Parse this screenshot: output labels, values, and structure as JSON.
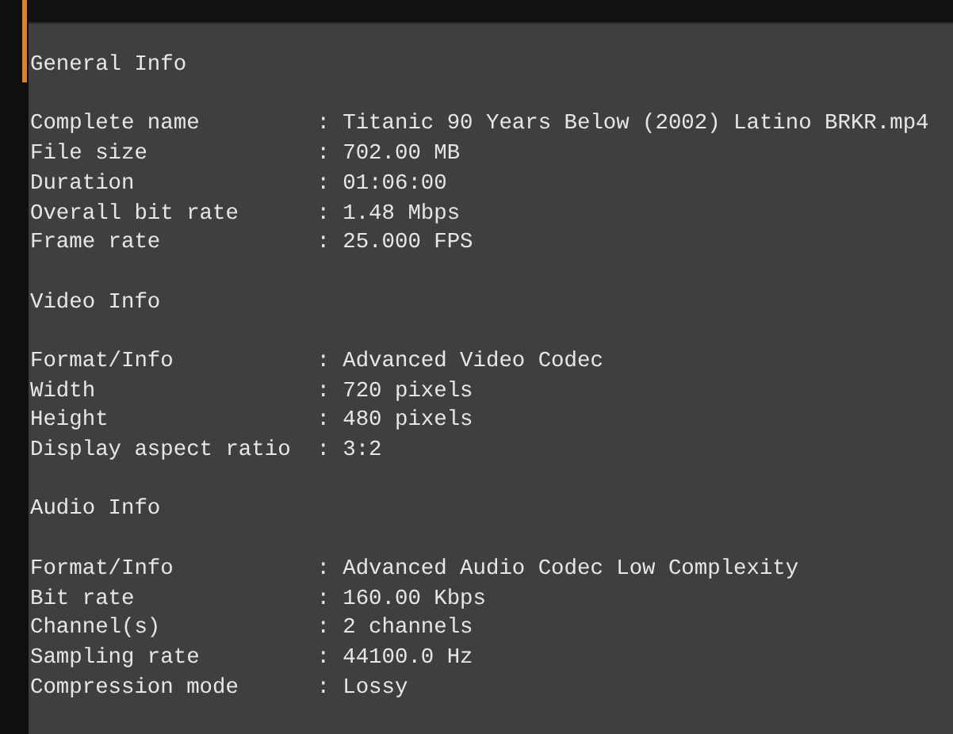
{
  "sections": [
    {
      "heading": "General Info",
      "rows": [
        {
          "label": "Complete name",
          "separator": ":",
          "value": "Titanic 90 Years Below (2002) Latino BRKR.mp4"
        },
        {
          "label": "File size",
          "separator": ":",
          "value": "702.00 MB"
        },
        {
          "label": "Duration",
          "separator": ":",
          "value": "01:06:00"
        },
        {
          "label": "Overall bit rate",
          "separator": ":",
          "value": "1.48 Mbps"
        },
        {
          "label": "Frame rate",
          "separator": ":",
          "value": "25.000 FPS"
        }
      ]
    },
    {
      "heading": "Video Info",
      "rows": [
        {
          "label": "Format/Info",
          "separator": ":",
          "value": "Advanced Video Codec"
        },
        {
          "label": "Width",
          "separator": ":",
          "value": "720 pixels"
        },
        {
          "label": "Height",
          "separator": ":",
          "value": "480 pixels"
        },
        {
          "label": "Display aspect ratio",
          "separator": ":",
          "value": "3:2"
        }
      ]
    },
    {
      "heading": "Audio Info",
      "rows": [
        {
          "label": "Format/Info",
          "separator": ":",
          "value": "Advanced Audio Codec Low Complexity"
        },
        {
          "label": "Bit rate",
          "separator": ":",
          "value": "160.00 Kbps"
        },
        {
          "label": "Channel(s)",
          "separator": ":",
          "value": "2 channels"
        },
        {
          "label": "Sampling rate",
          "separator": ":",
          "value": "44100.0 Hz"
        },
        {
          "label": "Compression mode",
          "separator": ":",
          "value": "Lossy"
        }
      ]
    }
  ]
}
